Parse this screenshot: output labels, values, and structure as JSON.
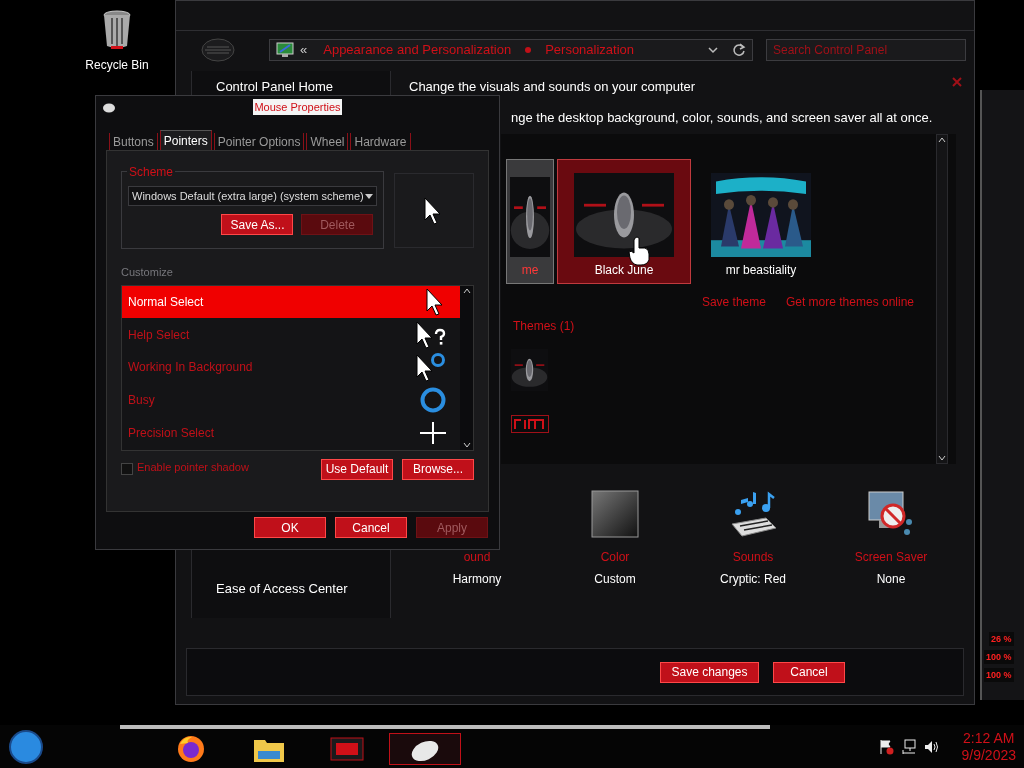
{
  "desktop": {
    "icons": [
      {
        "label": "Recycle Bin"
      }
    ]
  },
  "control_panel": {
    "back": "«",
    "breadcrumb": [
      "Appearance and Personalization",
      "Personalization"
    ],
    "search": {
      "placeholder": "Search Control Panel"
    },
    "sidebar": {
      "items": [
        "Control Panel Home"
      ],
      "see_also": [
        "Ease of Access Center"
      ]
    },
    "heading": "Change the visuals and sounds on your computer",
    "subheading": "nge the desktop background, color, sounds, and screen saver all at once.",
    "themes": [
      {
        "name": "me",
        "selected": false
      },
      {
        "name": "Black June",
        "selected": true
      },
      {
        "name": "mr beastiality",
        "selected": false
      }
    ],
    "links": [
      "Save theme",
      "Get more themes online"
    ],
    "installed_header": "Themes (1)",
    "settings": [
      {
        "label": "ound",
        "value": "Harmony",
        "kind": "background"
      },
      {
        "label": "Color",
        "value": "Custom",
        "kind": "color"
      },
      {
        "label": "Sounds",
        "value": "Cryptic: Red",
        "kind": "sounds"
      },
      {
        "label": "Screen Saver",
        "value": "None",
        "kind": "screensaver"
      }
    ],
    "buttons": [
      "Save changes",
      "Cancel"
    ]
  },
  "mouse_dialog": {
    "title": "Mouse Properties",
    "tabs": [
      {
        "label": "Buttons",
        "selected": false
      },
      {
        "label": "Pointers",
        "selected": true
      },
      {
        "label": "Pointer Options",
        "selected": false
      },
      {
        "label": "Wheel",
        "selected": false
      },
      {
        "label": "Hardware",
        "selected": false
      }
    ],
    "scheme": {
      "legend": "Scheme",
      "value": "Windows Default (extra large) (system scheme)",
      "buttons": [
        {
          "label": "Save As...",
          "disabled": false
        },
        {
          "label": "Delete",
          "disabled": true
        }
      ]
    },
    "customize_label": "Customize",
    "pointers": [
      {
        "name": "Normal Select",
        "kind": "arrow",
        "selected": true
      },
      {
        "name": "Help Select",
        "kind": "help",
        "selected": false
      },
      {
        "name": "Working In Background",
        "kind": "working",
        "selected": false
      },
      {
        "name": "Busy",
        "kind": "busy",
        "selected": false
      },
      {
        "name": "Precision Select",
        "kind": "cross",
        "selected": false
      }
    ],
    "shadow": {
      "label": "Enable pointer shadow",
      "checked": false
    },
    "list_buttons": [
      "Use Default",
      "Browse..."
    ],
    "buttons": [
      {
        "label": "OK",
        "disabled": false
      },
      {
        "label": "Cancel",
        "disabled": false
      },
      {
        "label": "Apply",
        "disabled": true
      }
    ]
  },
  "gadget": {
    "readings": [
      "26 %",
      "100 %",
      "100 %"
    ]
  },
  "taskbar": {
    "apps": [
      {
        "kind": "firefox",
        "active": false
      },
      {
        "kind": "explorer",
        "active": false
      },
      {
        "kind": "theme",
        "active": false
      },
      {
        "kind": "mouse",
        "active": true
      }
    ],
    "clock": {
      "time": "2:12 AM",
      "date": "9/9/2023"
    }
  }
}
